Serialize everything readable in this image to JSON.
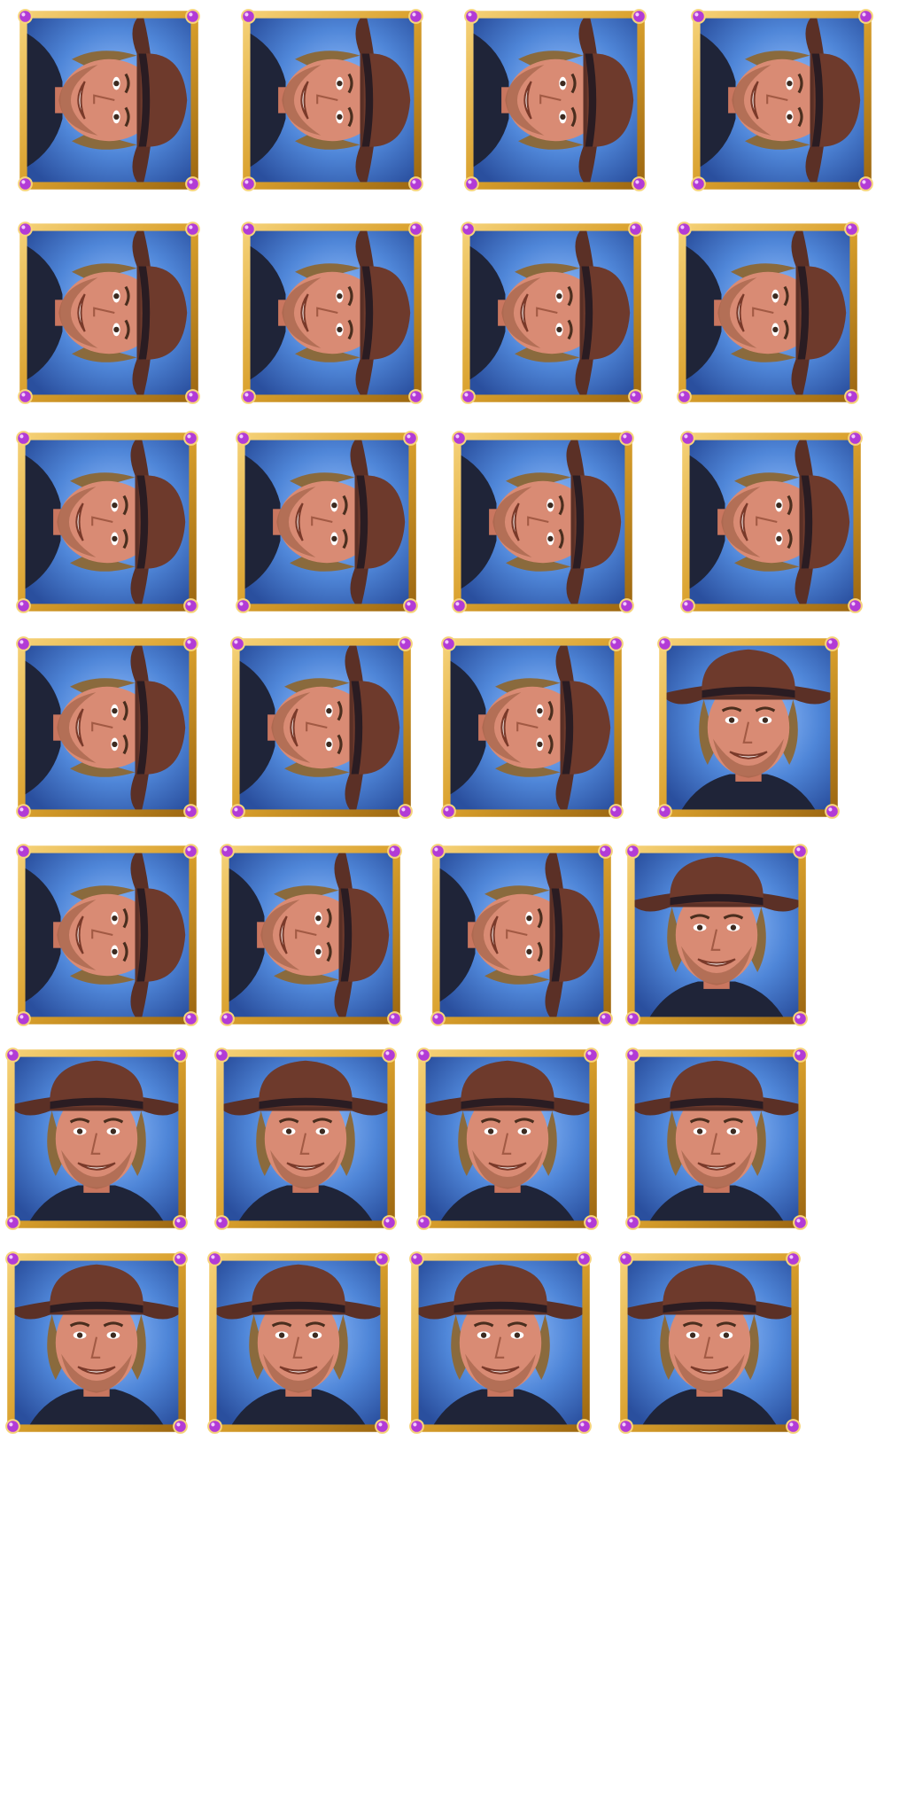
{
  "sheet": {
    "background": "#ffffff",
    "frame_gold": "#d9a02c",
    "frame_gold_dark": "#9a6510",
    "gem_purple": "#b23bd6",
    "sky_blue": "#4f86d8",
    "sky_blue_dark": "#2a4f9e",
    "hat_brown": "#5b3026",
    "skin": "#d98b74",
    "shirt": "#1f2438"
  },
  "sprites": {
    "rows": [
      [
        {
          "orientation": "rotated",
          "icon": "cowboy-portrait-icon"
        },
        {
          "orientation": "rotated",
          "icon": "cowboy-portrait-icon"
        },
        {
          "orientation": "rotated",
          "icon": "cowboy-portrait-icon"
        },
        {
          "orientation": "rotated",
          "icon": "cowboy-portrait-icon"
        }
      ],
      [
        {
          "orientation": "rotated",
          "icon": "cowboy-portrait-icon"
        },
        {
          "orientation": "rotated",
          "icon": "cowboy-portrait-icon"
        },
        {
          "orientation": "rotated",
          "icon": "cowboy-portrait-icon"
        },
        {
          "orientation": "rotated",
          "icon": "cowboy-portrait-icon"
        }
      ],
      [
        {
          "orientation": "rotated",
          "icon": "cowboy-portrait-icon"
        },
        {
          "orientation": "rotated",
          "icon": "cowboy-portrait-icon"
        },
        {
          "orientation": "rotated",
          "icon": "cowboy-portrait-icon"
        },
        {
          "orientation": "rotated",
          "icon": "cowboy-portrait-icon"
        }
      ],
      [
        {
          "orientation": "rotated",
          "icon": "cowboy-portrait-icon"
        },
        {
          "orientation": "rotated",
          "icon": "cowboy-portrait-icon"
        },
        {
          "orientation": "rotated",
          "icon": "cowboy-portrait-icon"
        },
        {
          "orientation": "upright",
          "icon": "cowboy-portrait-icon"
        }
      ],
      [
        {
          "orientation": "rotated",
          "icon": "cowboy-portrait-icon"
        },
        {
          "orientation": "rotated",
          "icon": "cowboy-portrait-icon"
        },
        {
          "orientation": "rotated",
          "icon": "cowboy-portrait-icon"
        },
        {
          "orientation": "upright",
          "icon": "cowboy-portrait-icon"
        }
      ],
      [
        {
          "orientation": "upright",
          "icon": "cowboy-portrait-icon"
        },
        {
          "orientation": "upright",
          "icon": "cowboy-portrait-icon"
        },
        {
          "orientation": "upright",
          "icon": "cowboy-portrait-icon"
        },
        {
          "orientation": "upright",
          "icon": "cowboy-portrait-icon"
        }
      ],
      [
        {
          "orientation": "upright",
          "icon": "cowboy-portrait-icon"
        },
        {
          "orientation": "upright",
          "icon": "cowboy-portrait-icon"
        },
        {
          "orientation": "upright",
          "icon": "cowboy-portrait-icon"
        },
        {
          "orientation": "upright",
          "icon": "cowboy-portrait-icon"
        }
      ]
    ]
  }
}
